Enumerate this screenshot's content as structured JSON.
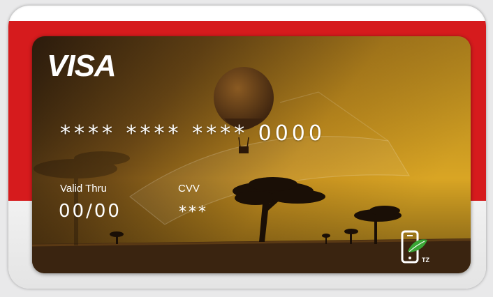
{
  "card": {
    "brand": "VISA",
    "number": "**** **** **** 0000",
    "valid_label": "Valid Thru",
    "valid_value": "00/00",
    "cvv_label": "CVV",
    "cvv_value": "***",
    "issuer_badge": "TZ",
    "icons": [
      "balloon-icon",
      "acacia-tree-icon",
      "phone-leaf-icon"
    ],
    "colors": {
      "frame_red": "#d61b1d",
      "card_gold": "#d39a1e",
      "card_dark": "#2b1a0c",
      "text": "#ffffff"
    }
  }
}
